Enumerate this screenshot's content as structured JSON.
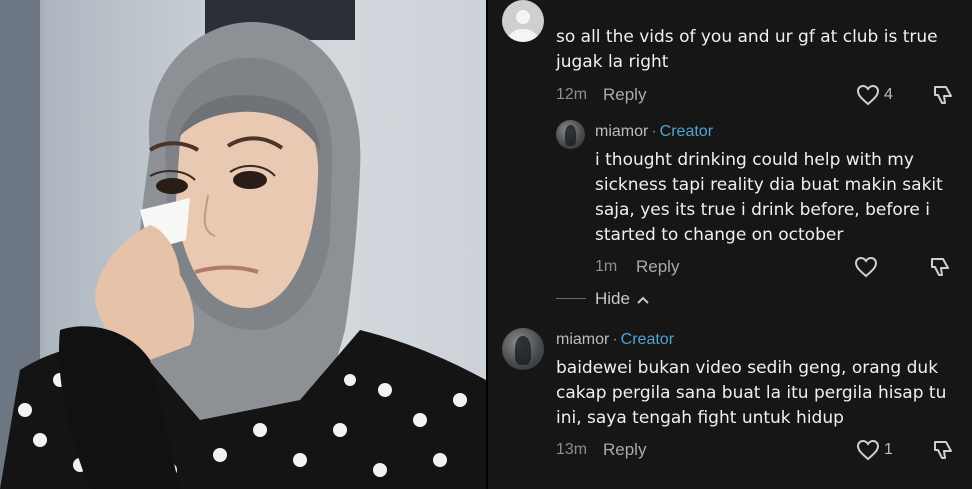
{
  "comments": [
    {
      "text_lines": [
        "so all the vids of you and ur gf at club is true",
        "jugak la right"
      ],
      "time": "12m",
      "reply_label": "Reply",
      "like_count": "4"
    },
    {
      "author": "miamor",
      "separator": "·",
      "badge": "Creator",
      "text_lines": [
        "i thought drinking could help with my",
        "sickness tapi reality dia buat makin sakit",
        "saja, yes its true i drink before, before i",
        "started to change on october"
      ],
      "time": "1m",
      "reply_label": "Reply"
    },
    {
      "hide_label": "Hide"
    },
    {
      "author": "miamor",
      "separator": "·",
      "badge": "Creator",
      "text_lines": [
        "baidewei bukan video sedih geng, orang duk",
        "cakap pergila sana buat la itu pergila hisap tu",
        "ini, saya tengah fight untuk hidup"
      ],
      "time": "13m",
      "reply_label": "Reply",
      "like_count": "1"
    }
  ],
  "colors": {
    "creator": "#4fa3d1",
    "background": "#161616",
    "meta": "#8e8e8e"
  },
  "icons": [
    "heart-icon",
    "dislike-icon",
    "chevron-up-icon",
    "default-avatar-icon"
  ]
}
